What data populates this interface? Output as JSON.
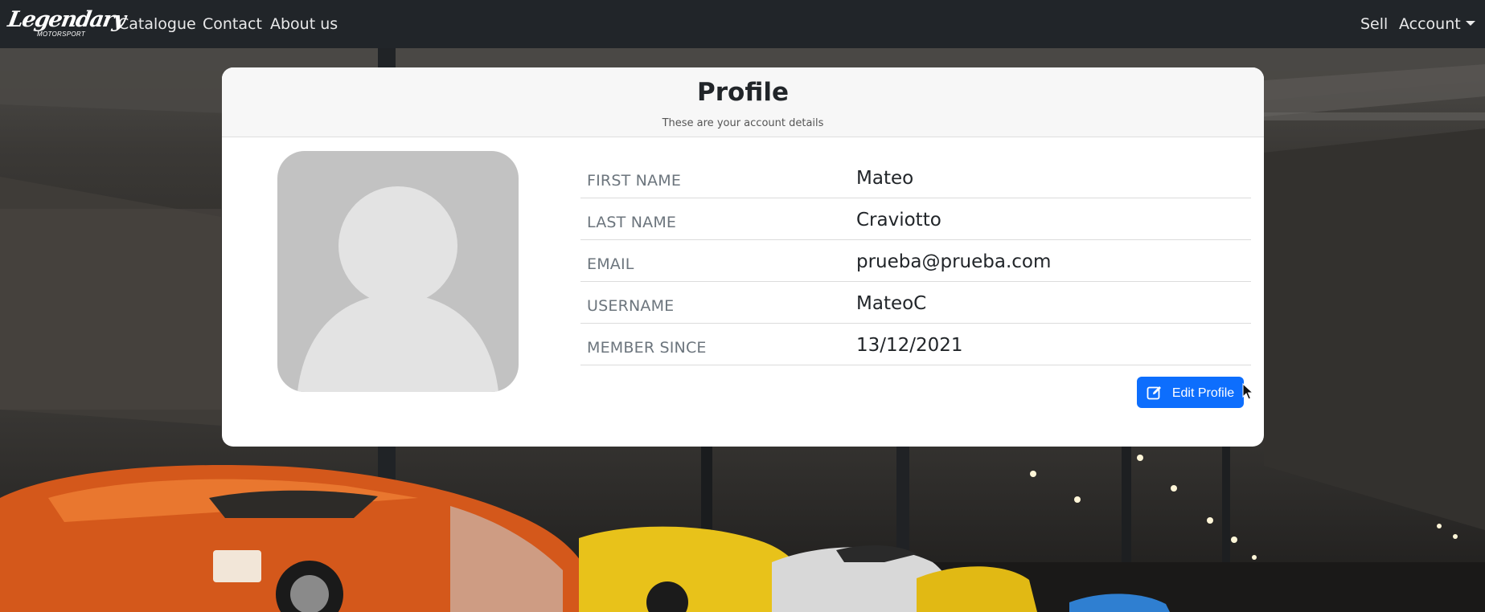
{
  "navbar": {
    "brand_script": "Legendary",
    "brand_sub": "MOTORSPORT",
    "links": {
      "catalogue": "Catalogue",
      "contact": "Contact",
      "about": "About us"
    },
    "right": {
      "sell": "Sell",
      "account": "Account"
    }
  },
  "profile": {
    "title": "Profile",
    "subtitle": "These are your account details",
    "fields": [
      {
        "label": "FIRST NAME",
        "value": "Mateo"
      },
      {
        "label": "LAST NAME",
        "value": "Craviotto"
      },
      {
        "label": "EMAIL",
        "value": "prueba@prueba.com"
      },
      {
        "label": "USERNAME",
        "value": "MateoC"
      },
      {
        "label": "MEMBER SINCE",
        "value": "13/12/2021"
      }
    ],
    "edit_label": "Edit Profile"
  },
  "icons": {
    "edit": "pencil-square-icon",
    "caret": "caret-down-icon",
    "avatar": "user-silhouette-icon"
  },
  "colors": {
    "navbar": "#212529",
    "primary": "#0d6efd",
    "card_header": "#f7f7f7",
    "avatar_bg": "#c2c2c2",
    "avatar_fg": "#e3e3e3"
  }
}
